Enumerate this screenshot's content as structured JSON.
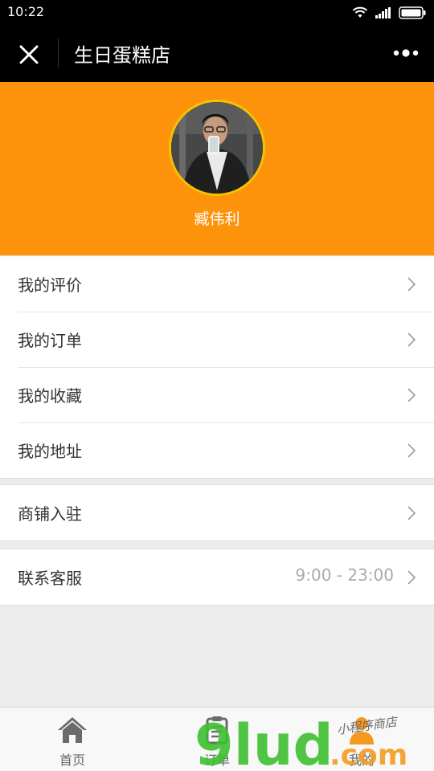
{
  "status_bar": {
    "time": "10:22"
  },
  "nav": {
    "title": "生日蛋糕店"
  },
  "profile": {
    "username": "臧伟利"
  },
  "menu_group_1": [
    {
      "label": "我的评价"
    },
    {
      "label": "我的订单"
    },
    {
      "label": "我的收藏"
    },
    {
      "label": "我的地址"
    }
  ],
  "menu_group_2": [
    {
      "label": "商铺入驻"
    }
  ],
  "menu_group_3": [
    {
      "label": "联系客服",
      "value": "9:00 - 23:00"
    }
  ],
  "tabbar": {
    "tabs": [
      {
        "label": "首页",
        "icon": "home-icon"
      },
      {
        "label": "订单",
        "icon": "order-icon"
      },
      {
        "label": "我的",
        "icon": "user-icon"
      }
    ]
  },
  "watermark": {
    "brand": "9lud",
    "suffix": ".com",
    "tagline": "小程序商店"
  },
  "colors": {
    "header_orange": "#fd930a",
    "avatar_ring": "#f2c400",
    "nav_bg": "#000000",
    "watermark_green": "#3dbf2f",
    "watermark_orange": "#f39a1e"
  }
}
